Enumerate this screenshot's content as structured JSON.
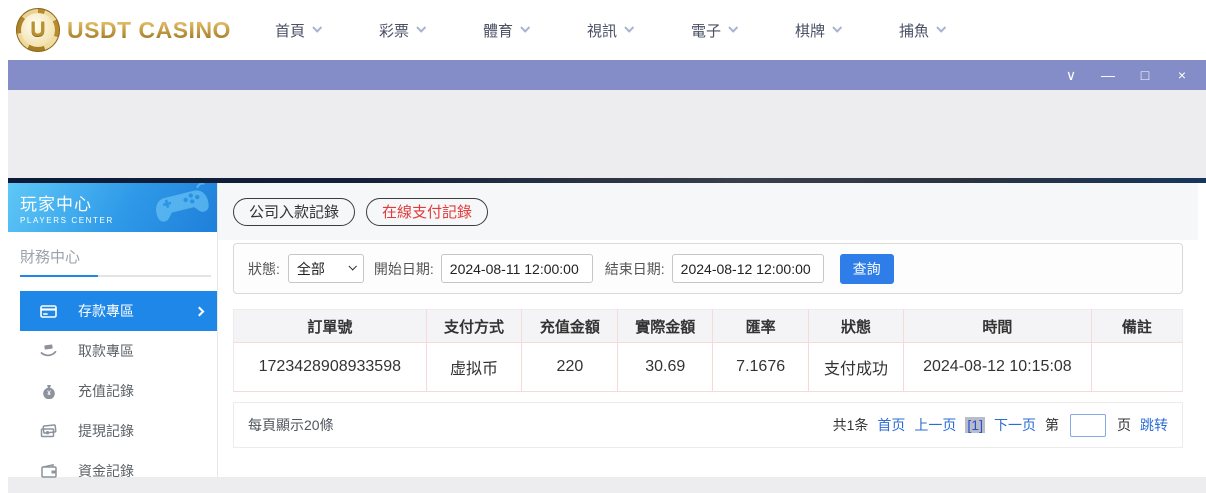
{
  "brand": {
    "name": "USDT CASINO",
    "logo_letter": "U"
  },
  "nav": {
    "items": [
      {
        "label": "首頁"
      },
      {
        "label": "彩票"
      },
      {
        "label": "體育"
      },
      {
        "label": "視訊"
      },
      {
        "label": "電子"
      },
      {
        "label": "棋牌"
      },
      {
        "label": "捕魚"
      }
    ]
  },
  "titlebar": {
    "collapse_icon": "∨",
    "minimize_icon": "—",
    "maximize_icon": "□",
    "close_icon": "×"
  },
  "sidebar": {
    "title": "玩家中心",
    "subtitle": "PLAYERS CENTER",
    "section_title": "財務中心",
    "items": [
      {
        "label": "存款專區",
        "active": true
      },
      {
        "label": "取款專區",
        "active": false
      },
      {
        "label": "充值記錄",
        "active": false
      },
      {
        "label": "提現記錄",
        "active": false
      },
      {
        "label": "資金記錄",
        "active": false
      }
    ]
  },
  "tabs": [
    {
      "label": "公司入款記錄",
      "active": false
    },
    {
      "label": "在線支付記錄",
      "active": true
    }
  ],
  "filters": {
    "status_label": "狀態:",
    "status_value": "全部",
    "start_label": "開始日期:",
    "start_value": "2024-08-11 12:00:00",
    "end_label": "結束日期:",
    "end_value": "2024-08-12 12:00:00",
    "search_button": "查詢"
  },
  "table": {
    "headers": [
      "訂單號",
      "支付方式",
      "充值金額",
      "實際金額",
      "匯率",
      "狀態",
      "時間",
      "備註"
    ],
    "rows": [
      [
        "1723428908933598",
        "虚拟币",
        "220",
        "30.69",
        "7.1676",
        "支付成功",
        "2024-08-12 10:15:08",
        ""
      ]
    ]
  },
  "pagination": {
    "per_page": "每頁顯示20條",
    "total": "共1条",
    "first": "首页",
    "prev": "上一页",
    "current": "[1]",
    "next": "下一页",
    "jump_prefix": "第",
    "jump_suffix": "页",
    "jump_action": "跳转"
  },
  "colors": {
    "accent_blue": "#1e87e8",
    "query_button_blue": "#2f7de9",
    "titlebar_purple": "#848dc7",
    "active_tab_red": "#e23b3b",
    "link_blue": "#2b6cd6",
    "brand_gold": "#c9a24a"
  }
}
